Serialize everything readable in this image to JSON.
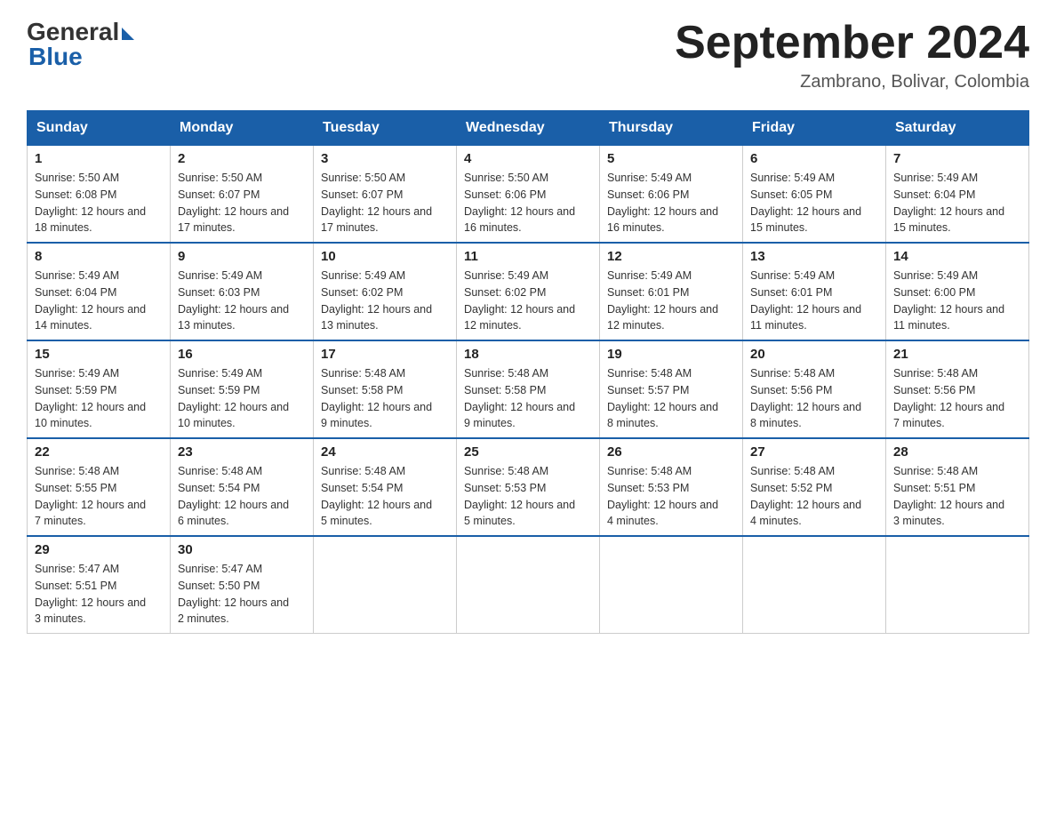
{
  "header": {
    "logo_general": "General",
    "logo_blue": "Blue",
    "month_title": "September 2024",
    "location": "Zambrano, Bolivar, Colombia"
  },
  "days_of_week": [
    "Sunday",
    "Monday",
    "Tuesday",
    "Wednesday",
    "Thursday",
    "Friday",
    "Saturday"
  ],
  "weeks": [
    [
      {
        "day": "1",
        "sunrise": "Sunrise: 5:50 AM",
        "sunset": "Sunset: 6:08 PM",
        "daylight": "Daylight: 12 hours and 18 minutes."
      },
      {
        "day": "2",
        "sunrise": "Sunrise: 5:50 AM",
        "sunset": "Sunset: 6:07 PM",
        "daylight": "Daylight: 12 hours and 17 minutes."
      },
      {
        "day": "3",
        "sunrise": "Sunrise: 5:50 AM",
        "sunset": "Sunset: 6:07 PM",
        "daylight": "Daylight: 12 hours and 17 minutes."
      },
      {
        "day": "4",
        "sunrise": "Sunrise: 5:50 AM",
        "sunset": "Sunset: 6:06 PM",
        "daylight": "Daylight: 12 hours and 16 minutes."
      },
      {
        "day": "5",
        "sunrise": "Sunrise: 5:49 AM",
        "sunset": "Sunset: 6:06 PM",
        "daylight": "Daylight: 12 hours and 16 minutes."
      },
      {
        "day": "6",
        "sunrise": "Sunrise: 5:49 AM",
        "sunset": "Sunset: 6:05 PM",
        "daylight": "Daylight: 12 hours and 15 minutes."
      },
      {
        "day": "7",
        "sunrise": "Sunrise: 5:49 AM",
        "sunset": "Sunset: 6:04 PM",
        "daylight": "Daylight: 12 hours and 15 minutes."
      }
    ],
    [
      {
        "day": "8",
        "sunrise": "Sunrise: 5:49 AM",
        "sunset": "Sunset: 6:04 PM",
        "daylight": "Daylight: 12 hours and 14 minutes."
      },
      {
        "day": "9",
        "sunrise": "Sunrise: 5:49 AM",
        "sunset": "Sunset: 6:03 PM",
        "daylight": "Daylight: 12 hours and 13 minutes."
      },
      {
        "day": "10",
        "sunrise": "Sunrise: 5:49 AM",
        "sunset": "Sunset: 6:02 PM",
        "daylight": "Daylight: 12 hours and 13 minutes."
      },
      {
        "day": "11",
        "sunrise": "Sunrise: 5:49 AM",
        "sunset": "Sunset: 6:02 PM",
        "daylight": "Daylight: 12 hours and 12 minutes."
      },
      {
        "day": "12",
        "sunrise": "Sunrise: 5:49 AM",
        "sunset": "Sunset: 6:01 PM",
        "daylight": "Daylight: 12 hours and 12 minutes."
      },
      {
        "day": "13",
        "sunrise": "Sunrise: 5:49 AM",
        "sunset": "Sunset: 6:01 PM",
        "daylight": "Daylight: 12 hours and 11 minutes."
      },
      {
        "day": "14",
        "sunrise": "Sunrise: 5:49 AM",
        "sunset": "Sunset: 6:00 PM",
        "daylight": "Daylight: 12 hours and 11 minutes."
      }
    ],
    [
      {
        "day": "15",
        "sunrise": "Sunrise: 5:49 AM",
        "sunset": "Sunset: 5:59 PM",
        "daylight": "Daylight: 12 hours and 10 minutes."
      },
      {
        "day": "16",
        "sunrise": "Sunrise: 5:49 AM",
        "sunset": "Sunset: 5:59 PM",
        "daylight": "Daylight: 12 hours and 10 minutes."
      },
      {
        "day": "17",
        "sunrise": "Sunrise: 5:48 AM",
        "sunset": "Sunset: 5:58 PM",
        "daylight": "Daylight: 12 hours and 9 minutes."
      },
      {
        "day": "18",
        "sunrise": "Sunrise: 5:48 AM",
        "sunset": "Sunset: 5:58 PM",
        "daylight": "Daylight: 12 hours and 9 minutes."
      },
      {
        "day": "19",
        "sunrise": "Sunrise: 5:48 AM",
        "sunset": "Sunset: 5:57 PM",
        "daylight": "Daylight: 12 hours and 8 minutes."
      },
      {
        "day": "20",
        "sunrise": "Sunrise: 5:48 AM",
        "sunset": "Sunset: 5:56 PM",
        "daylight": "Daylight: 12 hours and 8 minutes."
      },
      {
        "day": "21",
        "sunrise": "Sunrise: 5:48 AM",
        "sunset": "Sunset: 5:56 PM",
        "daylight": "Daylight: 12 hours and 7 minutes."
      }
    ],
    [
      {
        "day": "22",
        "sunrise": "Sunrise: 5:48 AM",
        "sunset": "Sunset: 5:55 PM",
        "daylight": "Daylight: 12 hours and 7 minutes."
      },
      {
        "day": "23",
        "sunrise": "Sunrise: 5:48 AM",
        "sunset": "Sunset: 5:54 PM",
        "daylight": "Daylight: 12 hours and 6 minutes."
      },
      {
        "day": "24",
        "sunrise": "Sunrise: 5:48 AM",
        "sunset": "Sunset: 5:54 PM",
        "daylight": "Daylight: 12 hours and 5 minutes."
      },
      {
        "day": "25",
        "sunrise": "Sunrise: 5:48 AM",
        "sunset": "Sunset: 5:53 PM",
        "daylight": "Daylight: 12 hours and 5 minutes."
      },
      {
        "day": "26",
        "sunrise": "Sunrise: 5:48 AM",
        "sunset": "Sunset: 5:53 PM",
        "daylight": "Daylight: 12 hours and 4 minutes."
      },
      {
        "day": "27",
        "sunrise": "Sunrise: 5:48 AM",
        "sunset": "Sunset: 5:52 PM",
        "daylight": "Daylight: 12 hours and 4 minutes."
      },
      {
        "day": "28",
        "sunrise": "Sunrise: 5:48 AM",
        "sunset": "Sunset: 5:51 PM",
        "daylight": "Daylight: 12 hours and 3 minutes."
      }
    ],
    [
      {
        "day": "29",
        "sunrise": "Sunrise: 5:47 AM",
        "sunset": "Sunset: 5:51 PM",
        "daylight": "Daylight: 12 hours and 3 minutes."
      },
      {
        "day": "30",
        "sunrise": "Sunrise: 5:47 AM",
        "sunset": "Sunset: 5:50 PM",
        "daylight": "Daylight: 12 hours and 2 minutes."
      },
      null,
      null,
      null,
      null,
      null
    ]
  ]
}
